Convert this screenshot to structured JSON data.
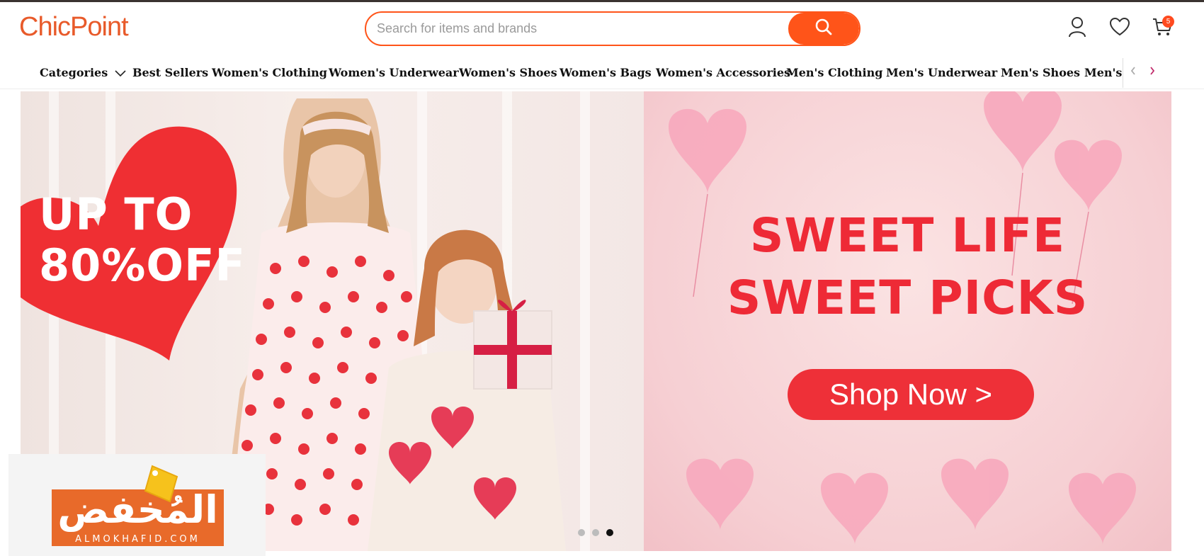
{
  "header": {
    "logo": "ChicPoint",
    "search": {
      "placeholder": "Search for items and brands",
      "button_icon": "search-icon"
    },
    "icons": [
      "user-icon",
      "heart-icon",
      "cart-icon"
    ],
    "cart_count": "5"
  },
  "nav": {
    "items": [
      {
        "label": "Categories"
      },
      {
        "label": "Best Sellers"
      },
      {
        "label": "Women's Clothing"
      },
      {
        "label": "Women's Underwear"
      },
      {
        "label": "Women's Shoes"
      },
      {
        "label": "Women's Bags"
      },
      {
        "label": "Women's Accessories"
      },
      {
        "label": "Men's Clothing"
      },
      {
        "label": "Men's Underwear"
      },
      {
        "label": "Men's Shoes"
      },
      {
        "label": "Men's Accessories"
      }
    ],
    "arrows": [
      "chevron-left-icon",
      "chevron-right-icon"
    ]
  },
  "banner": {
    "left_promo": [
      "UP TO",
      "80%OFF"
    ],
    "headline": [
      "SWEET LIFE",
      "SWEET PICKS"
    ],
    "cta": "Shop Now >",
    "slides_total": 3,
    "active_slide": 3
  },
  "watermark": {
    "arabic": "المُخفض",
    "latin": "ALMOKHAFID.COM"
  },
  "colors": {
    "brand": "#ff5419",
    "promo_red": "#ee2a36",
    "banner_pink": "#f6d4d6",
    "watermark_orange": "#e86a2a"
  }
}
